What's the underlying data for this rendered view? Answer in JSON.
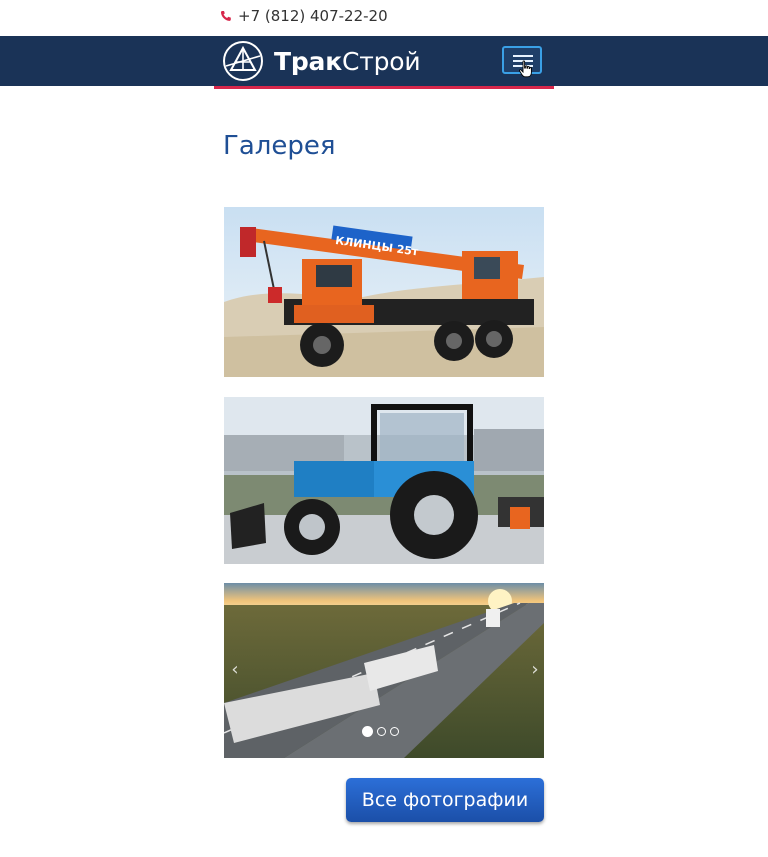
{
  "header": {
    "phone": "+7 (812) 407-22-20",
    "phone_icon": "phone-icon",
    "logo": {
      "part1": "Трак",
      "part2": "Строй",
      "icon": "truckstroy-logo-icon"
    },
    "menu_icon": "hamburger-menu-icon"
  },
  "gallery": {
    "title": "Галерея",
    "photos": [
      {
        "name": "crane-truck-photo",
        "label": "КЛИНЦЫ 25т"
      },
      {
        "name": "tractor-photo"
      },
      {
        "name": "highway-trucks-photo"
      }
    ],
    "prev_arrow": "‹",
    "next_arrow": "›",
    "dots": 3,
    "active_dot": 0,
    "all_photos_label": "Все фотографии"
  },
  "colors": {
    "navbar": "#1a3357",
    "accent_red": "#d7274b",
    "title_blue": "#1f4f95",
    "button_blue": "#2c6fd8"
  }
}
